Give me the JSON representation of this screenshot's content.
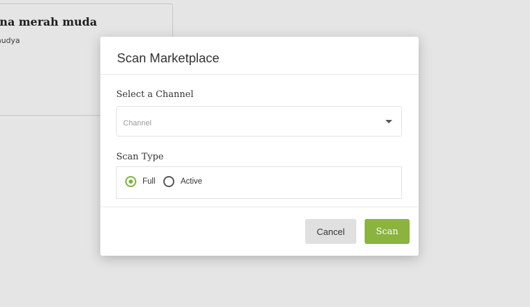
{
  "background": {
    "card_title": "rna merah muda",
    "card_subtitle": "mudya"
  },
  "modal": {
    "title": "Scan Marketplace",
    "channel_label": "Select a Channel",
    "channel_placeholder": "Channel",
    "scan_type_label": "Scan Type",
    "scan_type_options": [
      {
        "label": "Full",
        "checked": true
      },
      {
        "label": "Active",
        "checked": false
      }
    ],
    "cancel_label": "Cancel",
    "scan_label": "Scan"
  },
  "colors": {
    "accent": "#8ab43e",
    "cancel_bg": "#e0e0e0"
  }
}
